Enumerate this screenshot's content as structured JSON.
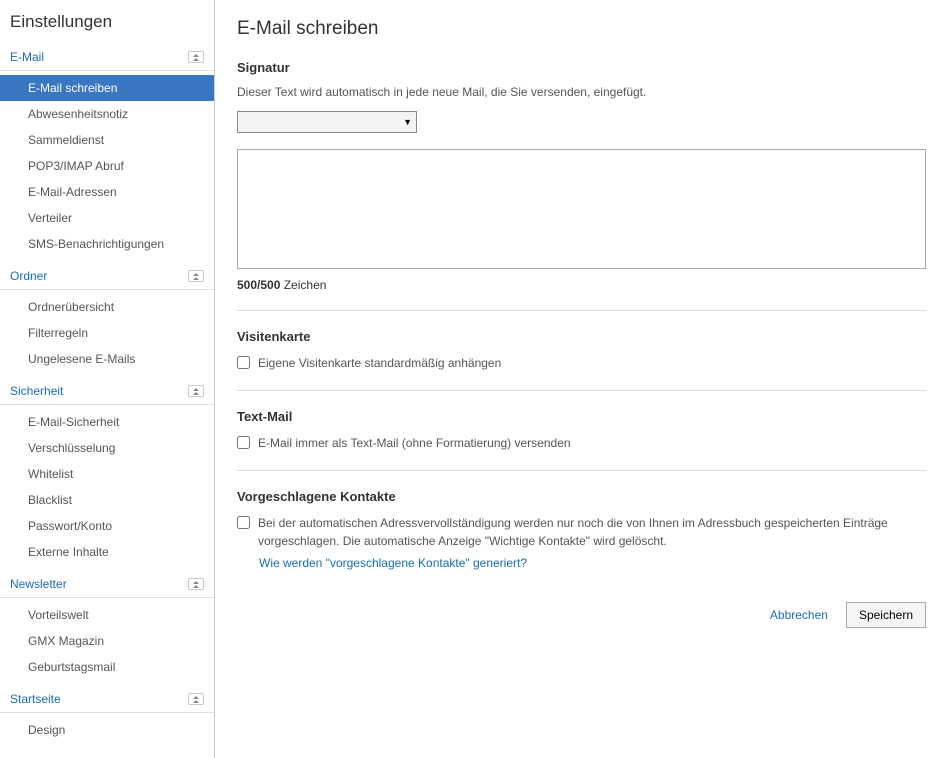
{
  "sidebar": {
    "title": "Einstellungen",
    "sections": [
      {
        "label": "E-Mail",
        "items": [
          {
            "label": "E-Mail schreiben",
            "active": true
          },
          {
            "label": "Abwesenheitsnotiz"
          },
          {
            "label": "Sammeldienst"
          },
          {
            "label": "POP3/IMAP Abruf"
          },
          {
            "label": "E-Mail-Adressen"
          },
          {
            "label": "Verteiler"
          },
          {
            "label": "SMS-Benachrichtigungen"
          }
        ]
      },
      {
        "label": "Ordner",
        "items": [
          {
            "label": "Ordnerübersicht"
          },
          {
            "label": "Filterregeln"
          },
          {
            "label": "Ungelesene E-Mails"
          }
        ]
      },
      {
        "label": "Sicherheit",
        "items": [
          {
            "label": "E-Mail-Sicherheit"
          },
          {
            "label": "Verschlüsselung"
          },
          {
            "label": "Whitelist"
          },
          {
            "label": "Blacklist"
          },
          {
            "label": "Passwort/Konto"
          },
          {
            "label": "Externe Inhalte"
          }
        ]
      },
      {
        "label": "Newsletter",
        "items": [
          {
            "label": "Vorteilswelt"
          },
          {
            "label": "GMX Magazin"
          },
          {
            "label": "Geburtstagsmail"
          }
        ]
      },
      {
        "label": "Startseite",
        "items": [
          {
            "label": "Design"
          }
        ]
      }
    ]
  },
  "main": {
    "title": "E-Mail schreiben",
    "signature": {
      "heading": "Signatur",
      "desc": "Dieser Text wird automatisch in jede neue Mail, die Sie versenden, eingefügt.",
      "select_value": "",
      "textarea_value": "",
      "counter_count": "500/500",
      "counter_label": " Zeichen"
    },
    "vcard": {
      "heading": "Visitenkarte",
      "checkbox_label": "Eigene Visitenkarte standardmäßig anhängen"
    },
    "textmail": {
      "heading": "Text-Mail",
      "checkbox_label": "E-Mail immer als Text-Mail (ohne Formatierung) versenden"
    },
    "contacts": {
      "heading": "Vorgeschlagene Kontakte",
      "checkbox_label": "Bei der automatischen Adressvervollständigung werden nur noch die von Ihnen im Adressbuch gespeicherten Einträge vorgeschlagen. Die automatische Anzeige \"Wichtige Kontakte\" wird gelöscht.",
      "help_link": "Wie werden \"vorgeschlagene Kontakte\" generiert?"
    },
    "buttons": {
      "cancel": "Abbrechen",
      "save": "Speichern"
    }
  }
}
